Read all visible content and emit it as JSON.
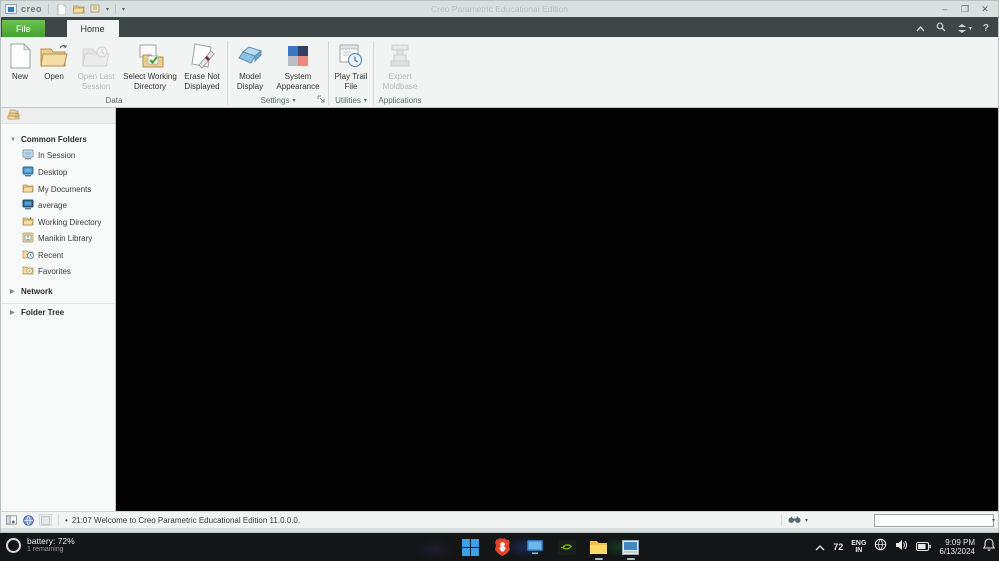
{
  "titlebar": {
    "logo_text": "creo",
    "title": "Creo Parametric Educational Edition"
  },
  "tabs": [
    {
      "label": "File"
    },
    {
      "label": "Home"
    }
  ],
  "ribbon": {
    "groups": [
      {
        "label": "Data",
        "buttons": [
          {
            "label": "New",
            "enabled": true
          },
          {
            "label": "Open",
            "enabled": true
          },
          {
            "label": "Open Last Session",
            "enabled": false
          },
          {
            "label": "Select Working Directory",
            "enabled": true
          },
          {
            "label": "Erase Not Displayed",
            "enabled": true
          }
        ]
      },
      {
        "label": "Settings",
        "has_dropdown": true,
        "buttons": [
          {
            "label": "Model Display",
            "enabled": true
          },
          {
            "label": "System Appearance",
            "enabled": true
          }
        ]
      },
      {
        "label": "Utilities",
        "has_dropdown": true,
        "buttons": [
          {
            "label": "Play Trail File",
            "enabled": true
          }
        ]
      },
      {
        "label": "Applications",
        "buttons": [
          {
            "label": "Expert Moldbase",
            "enabled": false
          }
        ]
      }
    ]
  },
  "sidebar": {
    "sections": [
      {
        "label": "Common Folders",
        "expanded": true,
        "items": [
          {
            "label": "In Session",
            "icon": "in-session-icon"
          },
          {
            "label": "Desktop",
            "icon": "desktop-icon"
          },
          {
            "label": "My Documents",
            "icon": "my-documents-icon"
          },
          {
            "label": "average",
            "icon": "computer-icon"
          },
          {
            "label": "Working Directory",
            "icon": "working-directory-icon"
          },
          {
            "label": "Manikin Library",
            "icon": "manikin-library-icon"
          },
          {
            "label": "Recent",
            "icon": "recent-icon"
          },
          {
            "label": "Favorites",
            "icon": "favorites-icon"
          }
        ]
      },
      {
        "label": "Network",
        "expanded": false
      },
      {
        "label": "Folder Tree",
        "expanded": false
      }
    ]
  },
  "statusbar": {
    "message": "21:07 Welcome to Creo Parametric Educational Edition 11.0.0.0.",
    "combo_value": ""
  },
  "taskbar": {
    "battery": {
      "label": "battery: 72%",
      "sub": "1 remaining"
    },
    "apps": [
      "windows-start",
      "brave-browser",
      "display",
      "nvidia",
      "file-explorer",
      "creo-window"
    ],
    "tray": {
      "number": "72",
      "lang_top": "ENG",
      "lang_bottom": "IN",
      "time": "9:09 PM",
      "date": "6/13/2024"
    }
  },
  "colors": {
    "file_tab_green": "#4fae3a",
    "tabbar_dark": "#3d4748",
    "titlebar_gray": "#d9e0e0",
    "canvas_black": "#020202"
  }
}
